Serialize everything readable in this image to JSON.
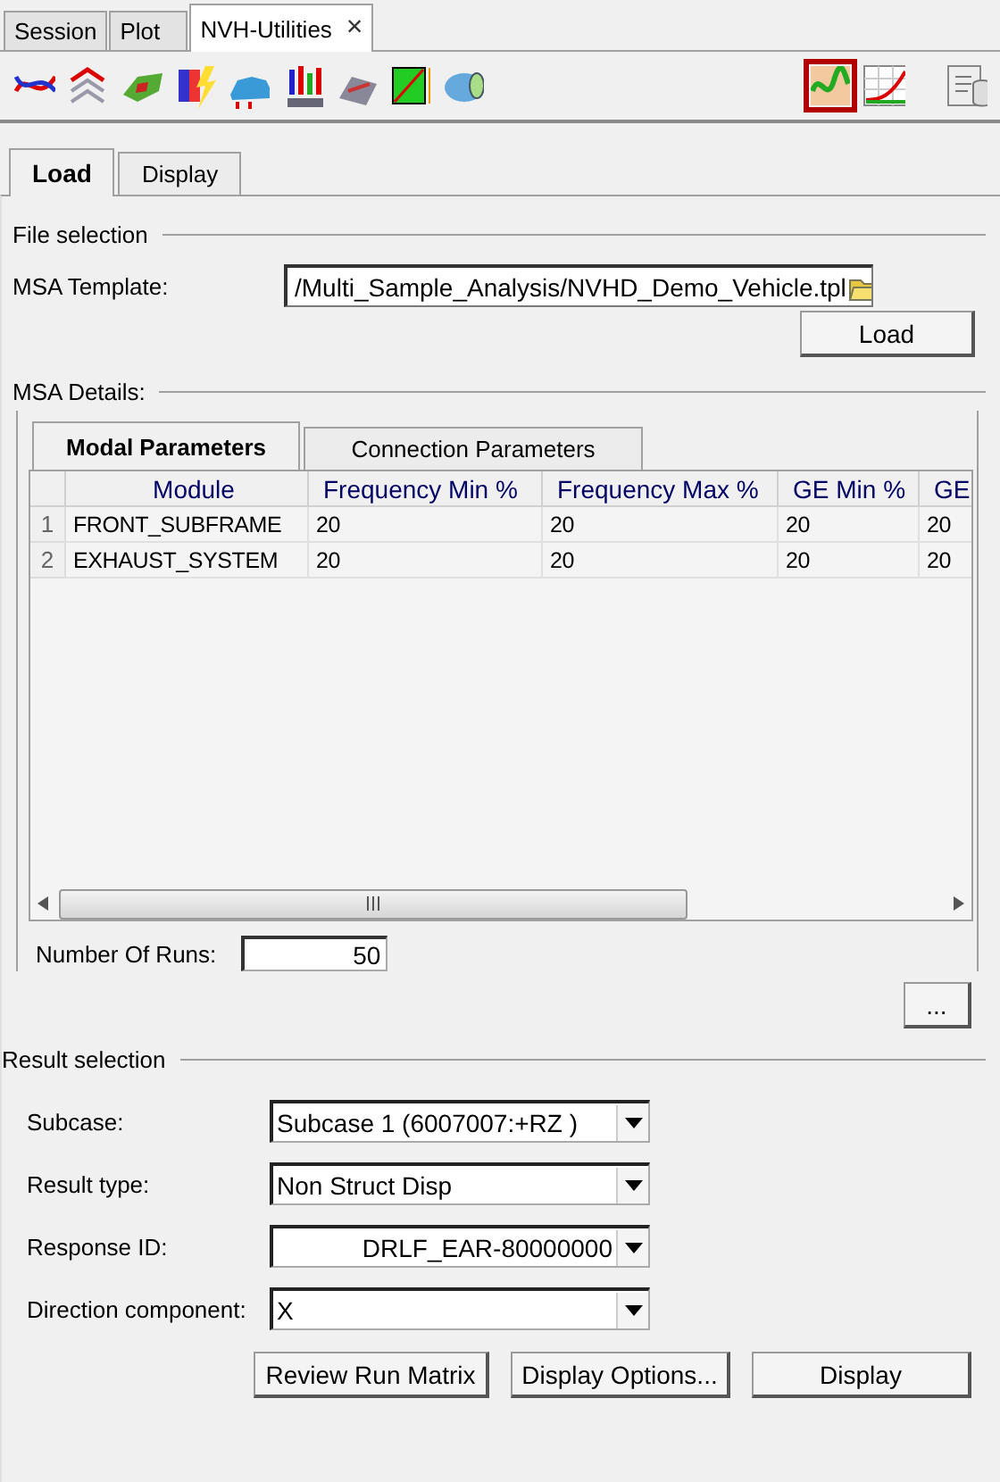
{
  "app_tabs": [
    {
      "label": "Session",
      "selected": false
    },
    {
      "label": "Plot",
      "selected": false
    },
    {
      "label": "NVH-Utilities",
      "selected": true,
      "close_glyph": "×"
    }
  ],
  "toolbar_right": [
    {
      "selected": true
    },
    {
      "selected": false
    }
  ],
  "panel_tabs": [
    {
      "label": "Load",
      "selected": true
    },
    {
      "label": "Display",
      "selected": false
    }
  ],
  "file_selection": {
    "title": "File selection",
    "template_label": "MSA Template:",
    "template_value": "/Multi_Sample_Analysis/NVHD_Demo_Vehicle.tpl",
    "load_button": "Load"
  },
  "msa_details": {
    "title": "MSA Details:",
    "tabs": [
      {
        "label": "Modal Parameters",
        "selected": true
      },
      {
        "label": "Connection Parameters",
        "selected": false
      }
    ],
    "table": {
      "columns": [
        "Module",
        "Frequency Min %",
        "Frequency Max %",
        "GE Min %",
        "GE"
      ],
      "rows": [
        {
          "index": "1",
          "cells": [
            "FRONT_SUBFRAME",
            "20",
            "20",
            "20",
            "20"
          ]
        },
        {
          "index": "2",
          "cells": [
            "EXHAUST_SYSTEM",
            "20",
            "20",
            "20",
            "20"
          ]
        }
      ]
    },
    "runs_label": "Number Of Runs:",
    "runs_value": "50"
  },
  "more_button": "...",
  "result_selection": {
    "title": "Result selection",
    "fields": [
      {
        "label": "Subcase:",
        "value": "Subcase 1 (6007007:+RZ )",
        "right_aligned": false
      },
      {
        "label": "Result type:",
        "value": "Non Struct Disp",
        "right_aligned": false
      },
      {
        "label": "Response ID:",
        "value": "DRLF_EAR-80000000",
        "right_aligned": true
      },
      {
        "label": "Direction component:",
        "value": "X",
        "right_aligned": false
      }
    ]
  },
  "buttons": [
    "Review Run Matrix",
    "Display Options...",
    "Display"
  ]
}
